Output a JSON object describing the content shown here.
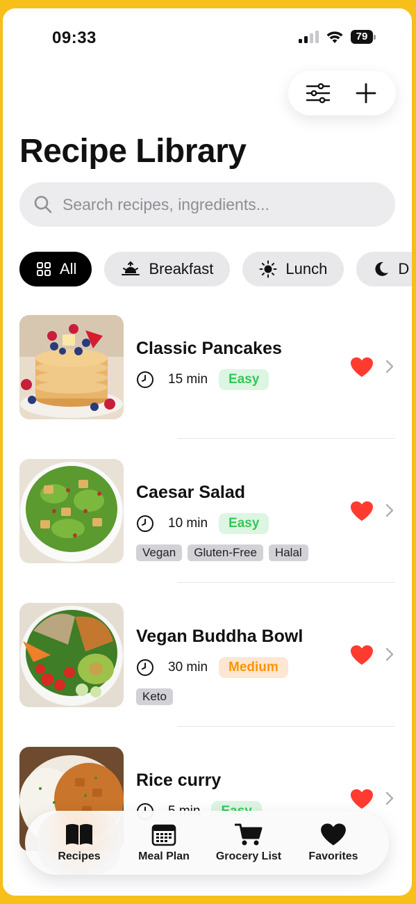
{
  "status": {
    "time": "09:33",
    "battery": "79"
  },
  "header": {
    "title": "Recipe Library"
  },
  "search": {
    "placeholder": "Search recipes, ingredients..."
  },
  "categories": [
    {
      "label": "All",
      "icon": "grid-icon",
      "active": true
    },
    {
      "label": "Breakfast",
      "icon": "sunrise-icon",
      "active": false
    },
    {
      "label": "Lunch",
      "icon": "sun-icon",
      "active": false
    },
    {
      "label": "D",
      "icon": "moon-icon",
      "active": false
    }
  ],
  "recipes": [
    {
      "title": "Classic Pancakes",
      "time": "15 min",
      "difficulty": "Easy",
      "tags": [],
      "favorite": true
    },
    {
      "title": "Caesar Salad",
      "time": "10 min",
      "difficulty": "Easy",
      "tags": [
        "Vegan",
        "Gluten-Free",
        "Halal"
      ],
      "favorite": true
    },
    {
      "title": "Vegan Buddha Bowl",
      "time": "30 min",
      "difficulty": "Medium",
      "tags": [
        "Keto"
      ],
      "favorite": true
    },
    {
      "title": "Rice curry",
      "time": "5 min",
      "difficulty": "Easy",
      "tags": [],
      "favorite": true
    }
  ],
  "colors": {
    "easy_bg": "#DDF5E3",
    "easy_text": "#34C759",
    "medium_bg": "#FDE6D2",
    "medium_text": "#FF9500",
    "heart": "#FF3B30",
    "frame": "#F7BF1A"
  },
  "tabbar": [
    {
      "label": "Recipes",
      "icon": "book-icon",
      "active": true
    },
    {
      "label": "Meal Plan",
      "icon": "calendar-icon",
      "active": false
    },
    {
      "label": "Grocery List",
      "icon": "cart-icon",
      "active": false
    },
    {
      "label": "Favorites",
      "icon": "heart-icon",
      "active": false
    }
  ]
}
